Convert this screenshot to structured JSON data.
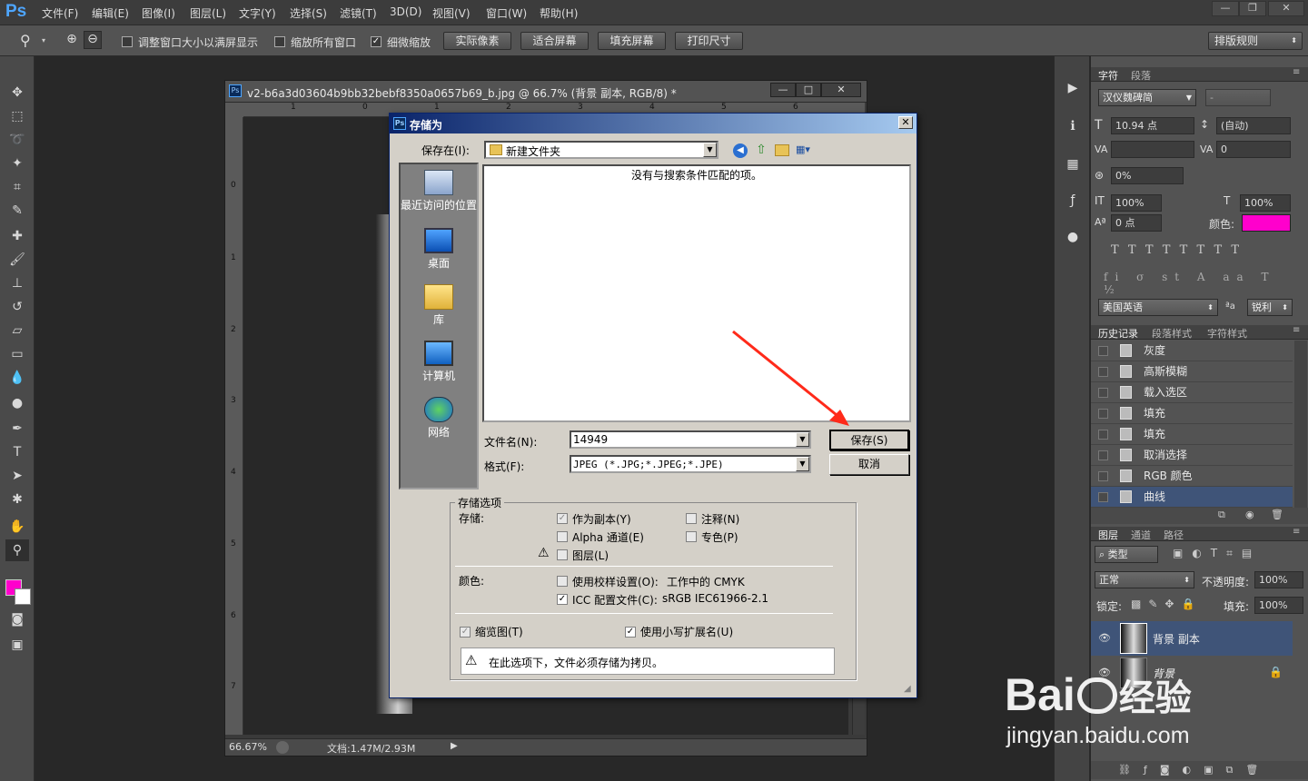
{
  "app": {
    "logo": "Ps"
  },
  "menu": [
    "文件(F)",
    "编辑(E)",
    "图像(I)",
    "图层(L)",
    "文字(Y)",
    "选择(S)",
    "滤镜(T)",
    "3D(D)",
    "视图(V)",
    "窗口(W)",
    "帮助(H)"
  ],
  "options": {
    "resize_windows": "调整窗口大小以满屏显示",
    "zoom_all": "缩放所有窗口",
    "scrubby": "细微缩放",
    "btn_actual": "实际像素",
    "btn_fit": "适合屏幕",
    "btn_fill": "填充屏幕",
    "btn_print": "打印尺寸",
    "workspace": "排版规则"
  },
  "document": {
    "title": "v2-b6a3d03604b9bb32bebf8350a0657b69_b.jpg @ 66.7% (背景 副本, RGB/8) *",
    "zoom": "66.67%",
    "doc_size": "文档:1.47M/2.93M",
    "ruler_h": [
      "1",
      "0",
      "1",
      "2",
      "3",
      "4",
      "5",
      "6"
    ],
    "ruler_v": [
      "0",
      "1",
      "2",
      "3",
      "4",
      "5",
      "6",
      "7"
    ]
  },
  "dialog": {
    "title": "存储为",
    "save_in_label": "保存在(I):",
    "save_in_value": "新建文件夹",
    "empty_message": "没有与搜索条件匹配的项。",
    "places": [
      "最近访问的位置",
      "桌面",
      "库",
      "计算机",
      "网络"
    ],
    "filename_label": "文件名(N):",
    "filename_value": "14949",
    "format_label": "格式(F):",
    "format_value": "JPEG (*.JPG;*.JPEG;*.JPE)",
    "save_button": "保存(S)",
    "cancel_button": "取消",
    "options_group": "存储选项",
    "store_label": "存储:",
    "as_copy": "作为副本(Y)",
    "notes": "注释(N)",
    "alpha": "Alpha 通道(E)",
    "spot": "专色(P)",
    "layers": "图层(L)",
    "color_label": "颜色:",
    "proof": "使用校样设置(O):",
    "proof_value": "工作中的 CMYK",
    "icc": "ICC 配置文件(C):",
    "icc_value": "sRGB IEC61966-2.1",
    "thumbnail": "缩览图(T)",
    "lowercase": "使用小写扩展名(U)",
    "warning": "在此选项下，文件必须存储为拷贝。"
  },
  "character_panel": {
    "tab1": "字符",
    "tab2": "段落",
    "font": "汉仪魏碑简",
    "style": "-",
    "size": "10.94 点",
    "leading": "(自动)",
    "kerning": "",
    "tracking": "0",
    "scale": "0%",
    "vscale": "100%",
    "hscale": "100%",
    "baseline": "0 点",
    "color_label": "颜色:",
    "language": "美国英语",
    "aa_label": "a",
    "antialias": "锐利"
  },
  "history_panel": {
    "tabs": [
      "历史记录",
      "段落样式",
      "字符样式"
    ],
    "items": [
      "灰度",
      "高斯模糊",
      "载入选区",
      "填充",
      "填充",
      "取消选择",
      "RGB 颜色",
      "曲线"
    ]
  },
  "layers_panel": {
    "tabs": [
      "图层",
      "通道",
      "路径"
    ],
    "filter": "类型",
    "blend": "正常",
    "opacity_label": "不透明度:",
    "opacity": "100%",
    "lock_label": "锁定:",
    "fill_label": "填充:",
    "fill": "100%",
    "layers": [
      "背景 副本",
      "背景"
    ]
  },
  "watermark": {
    "brand": "Bai",
    "brand2": "经验",
    "url": "jingyan.baidu.com"
  },
  "colors": {
    "foreground": "#ff00cc",
    "background": "#ffffff",
    "accent": "#0a246a"
  }
}
